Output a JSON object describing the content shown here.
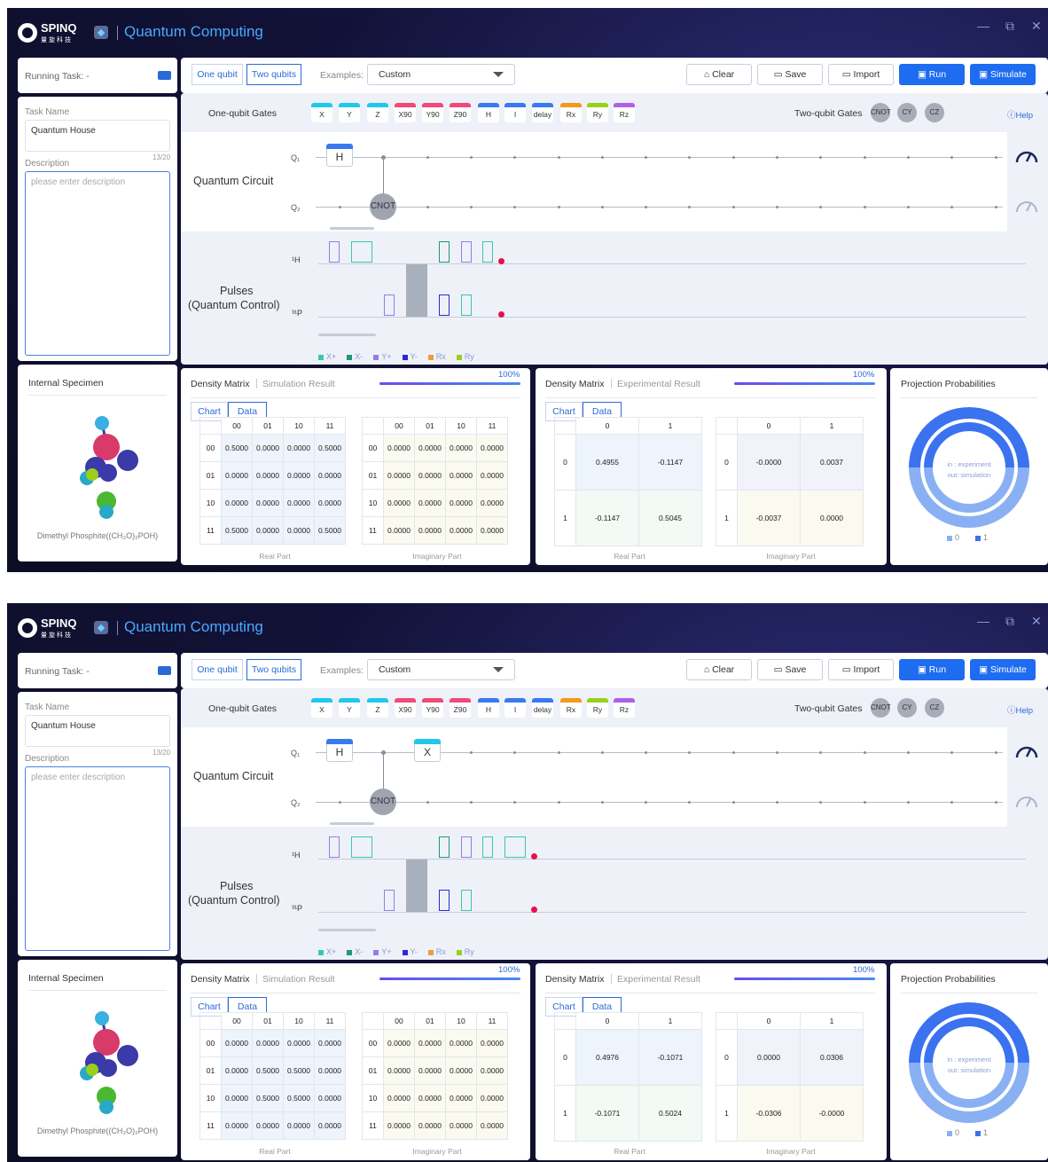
{
  "app": {
    "logo_text": "SPINQ",
    "logo_subtext": "量旋科技",
    "title": "Quantum Computing",
    "window_controls": [
      "—",
      "⧉",
      "✕"
    ]
  },
  "toolbar": {
    "mode_tabs": [
      "One qubit",
      "Two qubits"
    ],
    "active_mode": "Two qubits",
    "examples_label": "Examples:",
    "examples_value": "Custom",
    "clear_label": "Clear",
    "save_label": "Save",
    "import_label": "Import",
    "run_label": "Run",
    "simulate_label": "Simulate"
  },
  "gates_bar": {
    "one_qubit_label": "One-qubit Gates",
    "one_qubit_gates": [
      {
        "label": "X",
        "color": "#22c8ec"
      },
      {
        "label": "Y",
        "color": "#22c8ec"
      },
      {
        "label": "Z",
        "color": "#22c8ec"
      },
      {
        "label": "X90",
        "color": "#f04a7a"
      },
      {
        "label": "Y90",
        "color": "#f04a7a"
      },
      {
        "label": "Z90",
        "color": "#f04a7a"
      },
      {
        "label": "H",
        "color": "#3a7af0"
      },
      {
        "label": "I",
        "color": "#3a7af0"
      },
      {
        "label": "delay",
        "color": "#3a7af0"
      },
      {
        "label": "Rx",
        "color": "#f09a20"
      },
      {
        "label": "Ry",
        "color": "#9ad01a"
      },
      {
        "label": "Rz",
        "color": "#b060e8"
      }
    ],
    "two_qubit_label": "Two-qubit Gates",
    "two_qubit_gates": [
      "CNOT",
      "CY",
      "CZ"
    ],
    "help_label": "Help"
  },
  "sidebar": {
    "running_task_label": "Running Task: -",
    "task_name_label": "Task Name",
    "task_name_value": "Quantum House",
    "description_label": "Description",
    "description_count": "13/20",
    "description_placeholder": "please enter description"
  },
  "circuit": {
    "label": "Quantum Circuit",
    "qubit_labels": [
      "Q₁",
      "Q₂"
    ]
  },
  "pulses": {
    "label_line1": "Pulses",
    "label_line2": "(Quantum Control)",
    "channel_labels": [
      "¹H",
      "³¹P"
    ],
    "legend": [
      {
        "label": "X+",
        "color": "#3ac8a8"
      },
      {
        "label": "X-",
        "color": "#1a9a78"
      },
      {
        "label": "Y+",
        "color": "#9a7ae8"
      },
      {
        "label": "Y-",
        "color": "#2a2ad8"
      },
      {
        "label": "Rx",
        "color": "#f09a40"
      },
      {
        "label": "Ry",
        "color": "#9ad01a"
      }
    ]
  },
  "specimen": {
    "title": "Internal Specimen",
    "caption": "Dimethyl Phosphite((CH₃O)₂POH)"
  },
  "sim_panel": {
    "title": "Density Matrix",
    "subtitle": "Simulation Result",
    "progress": "100%",
    "tabs": [
      "Chart",
      "Data"
    ],
    "headers": [
      "00",
      "01",
      "10",
      "11"
    ],
    "real_label": "Real Part",
    "imag_label": "Imaginary Part"
  },
  "exp_panel": {
    "title": "Density Matrix",
    "subtitle": "Experimental Result",
    "progress": "100%",
    "tabs": [
      "Chart",
      "Data"
    ],
    "headers": [
      "0",
      "1"
    ],
    "real_label": "Real Part",
    "imag_label": "Imaginary Part"
  },
  "proj_panel": {
    "title": "Projection Probabilities",
    "in_label": "in : experiment",
    "out_label": "out: simulation",
    "legend": [
      "0",
      "1"
    ]
  },
  "screens": [
    {
      "circuit_q1_extra_gate": null,
      "sim_real": [
        [
          "0.5000",
          "0.0000",
          "0.0000",
          "0.5000"
        ],
        [
          "0.0000",
          "0.0000",
          "0.0000",
          "0.0000"
        ],
        [
          "0.0000",
          "0.0000",
          "0.0000",
          "0.0000"
        ],
        [
          "0.5000",
          "0.0000",
          "0.0000",
          "0.5000"
        ]
      ],
      "sim_imag": [
        [
          "0.0000",
          "0.0000",
          "0.0000",
          "0.0000"
        ],
        [
          "0.0000",
          "0.0000",
          "0.0000",
          "0.0000"
        ],
        [
          "0.0000",
          "0.0000",
          "0.0000",
          "0.0000"
        ],
        [
          "0.0000",
          "0.0000",
          "0.0000",
          "0.0000"
        ]
      ],
      "exp_real": [
        [
          "0.4955",
          "-0.1147"
        ],
        [
          "-0.1147",
          "0.5045"
        ]
      ],
      "exp_imag": [
        [
          "-0.0000",
          "0.0037"
        ],
        [
          "-0.0037",
          "0.0000"
        ]
      ]
    },
    {
      "circuit_q1_extra_gate": "X",
      "sim_real": [
        [
          "0.0000",
          "0.0000",
          "0.0000",
          "0.0000"
        ],
        [
          "0.0000",
          "0.5000",
          "0.5000",
          "0.0000"
        ],
        [
          "0.0000",
          "0.5000",
          "0.5000",
          "0.0000"
        ],
        [
          "0.0000",
          "0.0000",
          "0.0000",
          "0.0000"
        ]
      ],
      "sim_imag": [
        [
          "0.0000",
          "0.0000",
          "0.0000",
          "0.0000"
        ],
        [
          "0.0000",
          "0.0000",
          "0.0000",
          "0.0000"
        ],
        [
          "0.0000",
          "0.0000",
          "0.0000",
          "0.0000"
        ],
        [
          "0.0000",
          "0.0000",
          "0.0000",
          "0.0000"
        ]
      ],
      "exp_real": [
        [
          "0.4976",
          "-0.1071"
        ],
        [
          "-0.1071",
          "0.5024"
        ]
      ],
      "exp_imag": [
        [
          "0.0000",
          "0.0306"
        ],
        [
          "-0.0306",
          "-0.0000"
        ]
      ]
    }
  ]
}
